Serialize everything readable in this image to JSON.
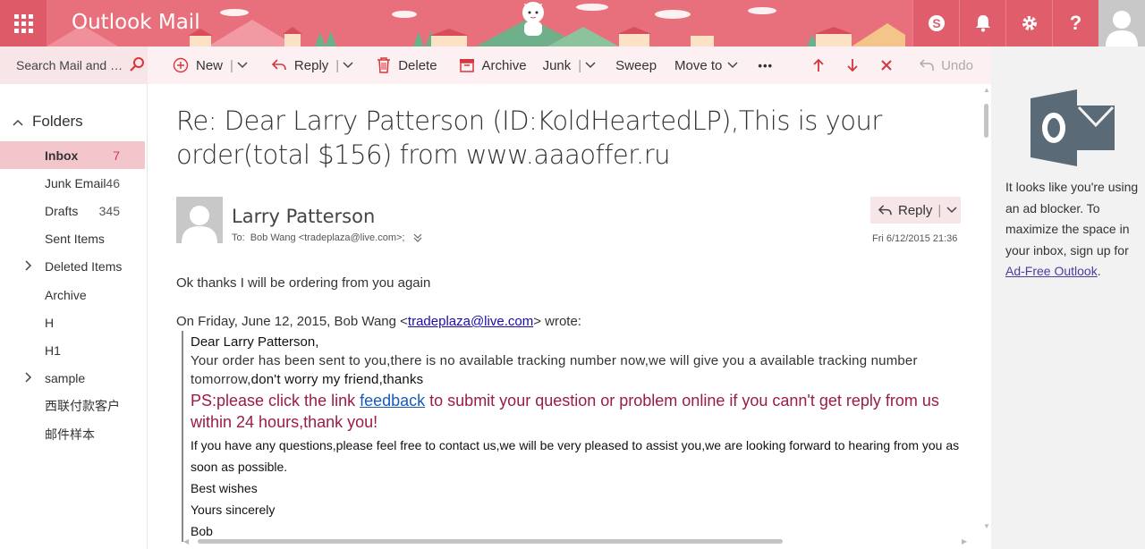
{
  "header": {
    "app_title": "Outlook Mail",
    "icons": [
      "waffle-icon",
      "skype-icon",
      "bell-icon",
      "gear-icon",
      "help-icon",
      "profile-avatar"
    ]
  },
  "search": {
    "placeholder": "Search Mail and People"
  },
  "folders": {
    "heading": "Folders",
    "items": [
      {
        "label": "Inbox",
        "count": "7",
        "active": true,
        "expandable": false
      },
      {
        "label": "Junk Email",
        "count": "46",
        "active": false,
        "expandable": false
      },
      {
        "label": "Drafts",
        "count": "345",
        "active": false,
        "expandable": false
      },
      {
        "label": "Sent Items",
        "count": "",
        "active": false,
        "expandable": false
      },
      {
        "label": "Deleted Items",
        "count": "",
        "active": false,
        "expandable": true
      },
      {
        "label": "Archive",
        "count": "",
        "active": false,
        "expandable": false
      },
      {
        "label": "H",
        "count": "",
        "active": false,
        "expandable": false
      },
      {
        "label": "H1",
        "count": "",
        "active": false,
        "expandable": false
      },
      {
        "label": "sample",
        "count": "",
        "active": false,
        "expandable": true
      },
      {
        "label": "西联付款客户",
        "count": "",
        "active": false,
        "expandable": false
      },
      {
        "label": "邮件样本",
        "count": "",
        "active": false,
        "expandable": false
      }
    ]
  },
  "toolbar": {
    "new_label": "New",
    "reply_label": "Reply",
    "delete_label": "Delete",
    "archive_label": "Archive",
    "junk_label": "Junk",
    "sweep_label": "Sweep",
    "moveto_label": "Move to",
    "more_label": "•••",
    "undo_label": "Undo"
  },
  "message": {
    "subject": "Re: Dear Larry Patterson (ID:KoldHeartedLP),This is your order(total $156) from www.aaaoffer.ru",
    "sender": "Larry Patterson",
    "to_prefix": "To:",
    "to_value": "Bob Wang <tradeplaza@live.com>;",
    "date": "Fri 6/12/2015 21:36",
    "reply_label": "Reply",
    "body_line": "Ok thanks I will be ordering from you again",
    "quote_header_pre": "On Friday, June 12, 2015, Bob Wang <",
    "quote_header_link": "tradeplaza@live.com",
    "quote_header_post": "> wrote:",
    "quote": {
      "greeting": "Dear Larry Patterson,",
      "order_line": "Your order has been sent to you,there is no available tracking number now,we will give you a available tracking number tomorrow,",
      "order_tail": "don't worry my friend,thanks",
      "ps_pre": "PS:please click the link ",
      "ps_link": "feedback",
      "ps_post": " to submit your question or problem online if you cann't get reply from us within 24 hours,thank you!",
      "contact": "If you have any questions,please feel free to contact us,we will be very pleased to assist you,we are looking forward to hearing from you as soon as possible.",
      "best_wishes": "Best wishes",
      "yours": "Yours sincerely",
      "signature": "Bob"
    }
  },
  "ad": {
    "text": "It looks like you're using an ad blocker. To maximize the space in your inbox, sign up for ",
    "link": "Ad-Free Outlook",
    "tail": "."
  },
  "colors": {
    "header_bg": "#e8707c",
    "active_folder_bg": "#f3c6cb",
    "accent_red": "#d6363c",
    "ps_text": "#9b1b4a",
    "outlook_blue_gray": "#5a6a76"
  }
}
